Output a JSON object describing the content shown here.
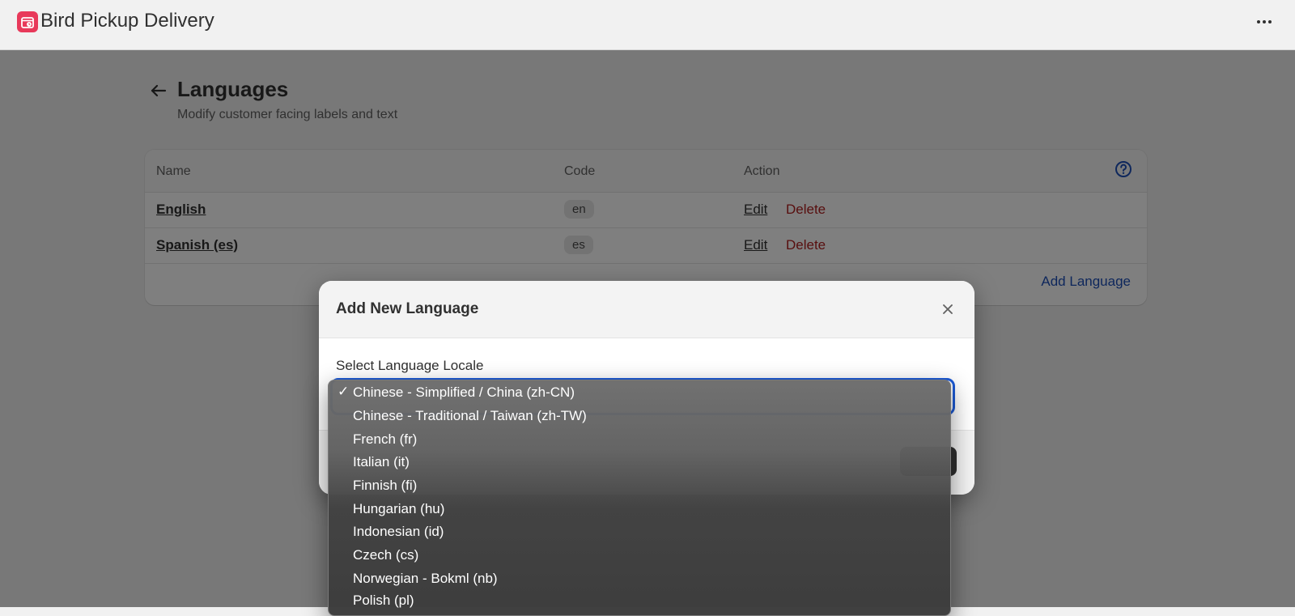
{
  "app": {
    "title": "Bird Pickup Delivery"
  },
  "header": {
    "title": "Languages",
    "subtitle": "Modify customer facing labels and text"
  },
  "table": {
    "columns": [
      "Name",
      "Code",
      "Action"
    ],
    "rows": [
      {
        "name": "English",
        "code": "en",
        "edit": "Edit",
        "delete": "Delete"
      },
      {
        "name": "Spanish (es)",
        "code": "es",
        "edit": "Edit",
        "delete": "Delete"
      }
    ],
    "add_label": "Add Language"
  },
  "modal": {
    "title": "Add New Language",
    "field_label": "Select Language Locale",
    "dropdown": {
      "selected_index": 0,
      "check_glyph": "✓",
      "options": [
        "Chinese - Simplified / China (zh-CN)",
        "Chinese - Traditional / Taiwan (zh-TW)",
        "French (fr)",
        "Italian (it)",
        "Finnish (fi)",
        "Hungarian (hu)",
        "Indonesian (id)",
        "Czech (cs)",
        "Norwegian - Bokml (nb)",
        "Polish (pl)"
      ]
    }
  },
  "colors": {
    "accent": "#1d5bd6",
    "danger": "#b01e1e",
    "logo": "#e8395a",
    "link": "#1d4fb8"
  }
}
